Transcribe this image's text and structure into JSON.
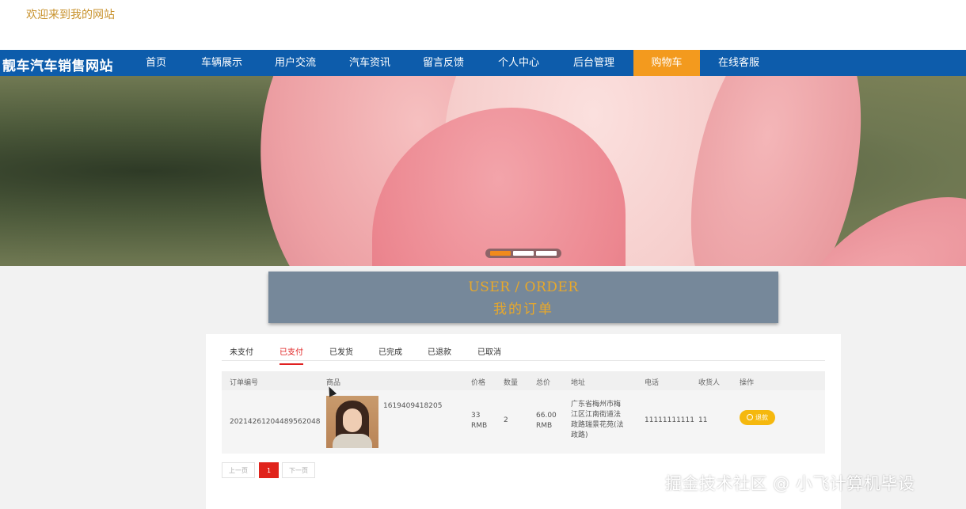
{
  "header": {
    "welcome": "欢迎来到我的网站"
  },
  "nav": {
    "brand": "靓车汽车销售网站",
    "items": [
      {
        "label": "首页",
        "active": false
      },
      {
        "label": "车辆展示",
        "active": false
      },
      {
        "label": "用户交流",
        "active": false
      },
      {
        "label": "汽车资讯",
        "active": false
      },
      {
        "label": "留言反馈",
        "active": false
      },
      {
        "label": "个人中心",
        "active": false
      },
      {
        "label": "后台管理",
        "active": false
      },
      {
        "label": "购物车",
        "active": true
      },
      {
        "label": "在线客服",
        "active": false
      }
    ],
    "bg_color": "#0d5cab",
    "active_color": "#f39a1e"
  },
  "carousel": {
    "slide_count": 3,
    "active_index": 0
  },
  "order_header": {
    "title_en": "USER / ORDER",
    "title_cn": "我的订单"
  },
  "tabs": [
    {
      "label": "未支付",
      "active": false
    },
    {
      "label": "已支付",
      "active": true
    },
    {
      "label": "已发货",
      "active": false
    },
    {
      "label": "已完成",
      "active": false
    },
    {
      "label": "已退款",
      "active": false
    },
    {
      "label": "已取消",
      "active": false
    }
  ],
  "table": {
    "columns": [
      "订单编号",
      "商品",
      "价格",
      "数量",
      "总价",
      "地址",
      "电话",
      "收货人",
      "操作"
    ],
    "rows": [
      {
        "order_no": "20214261204489562048",
        "product_code": "1619409418205",
        "price_value": "33",
        "price_unit": "RMB",
        "quantity": "2",
        "total_value": "66.00",
        "total_unit": "RMB",
        "address_lines": [
          "广东省梅州市梅",
          "江区江南街道法",
          "政路瑞景花苑(法",
          "政路)"
        ],
        "phone": "11111111111",
        "receiver": "11",
        "action_label": "退款"
      }
    ]
  },
  "pagination": {
    "prev": "上一页",
    "current": "1",
    "next": "下一页"
  },
  "watermark": "掘金技术社区 @ 小飞计算机毕设"
}
